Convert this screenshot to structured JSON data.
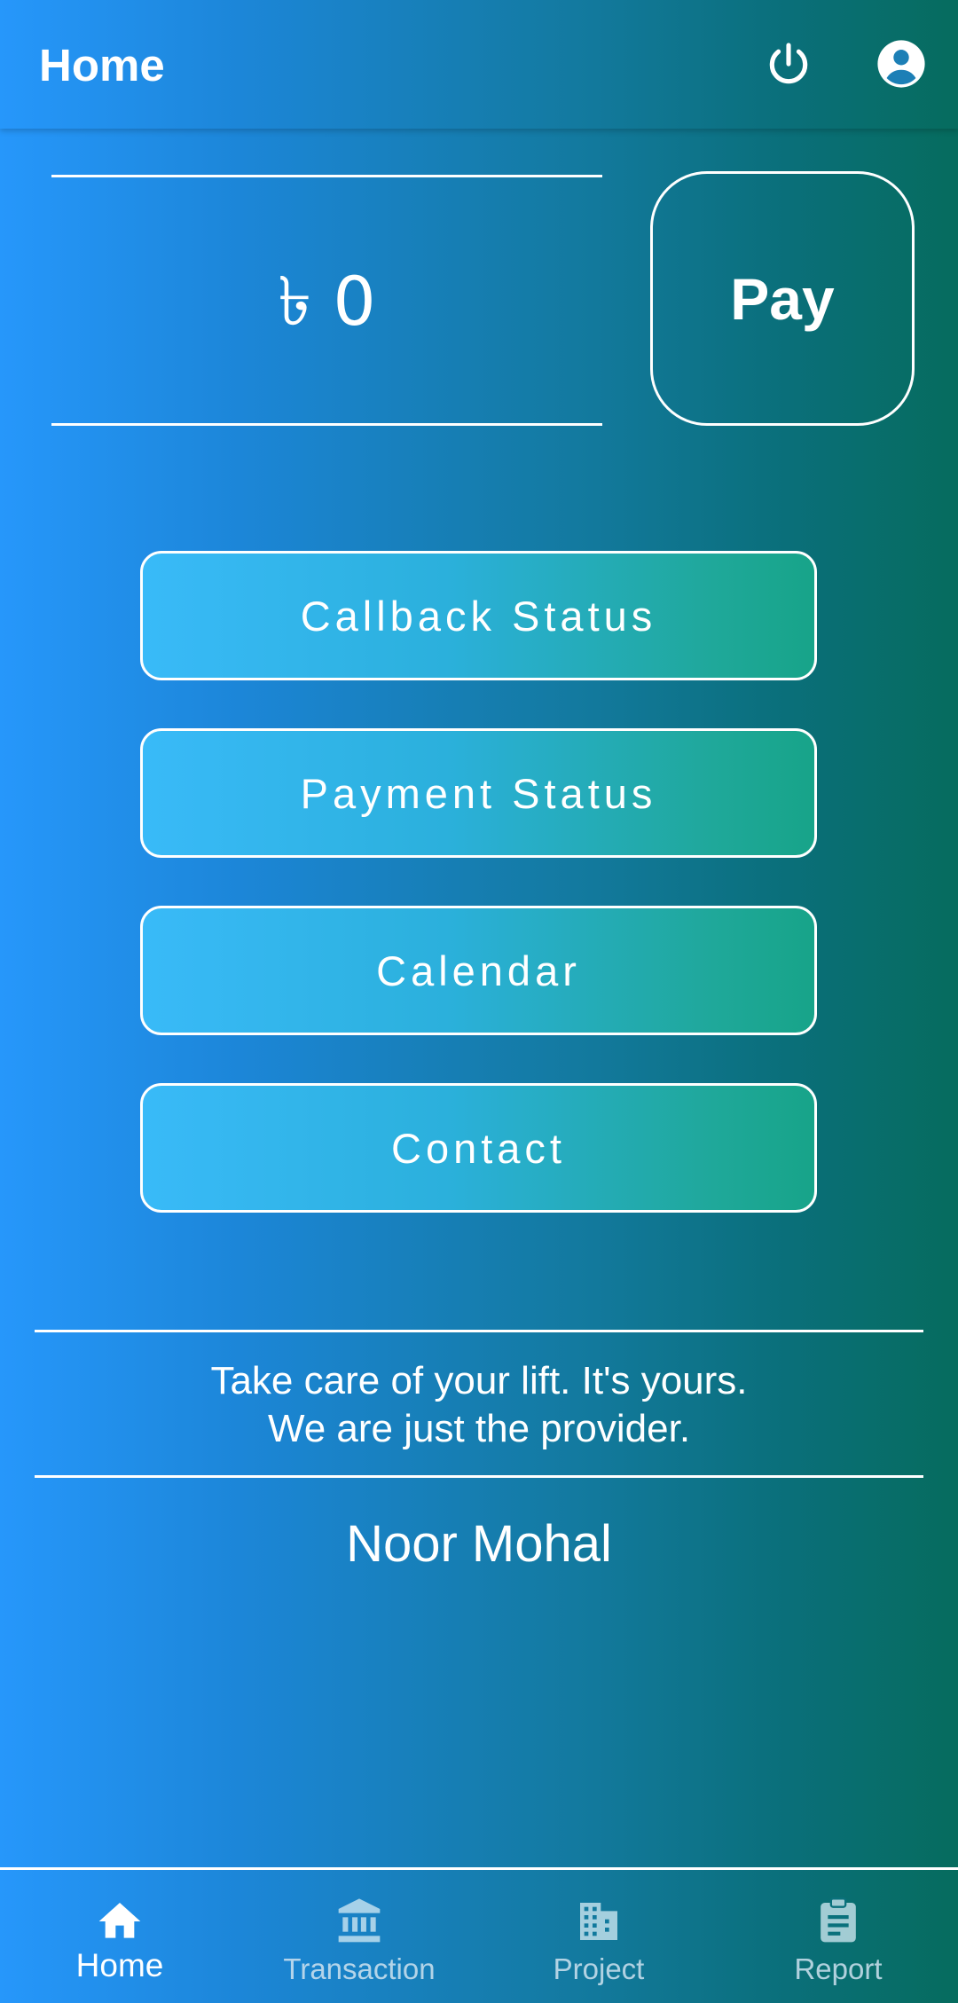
{
  "appbar": {
    "title": "Home",
    "power_icon": "power-icon",
    "account_icon": "account-circle-icon"
  },
  "balance": {
    "amount": "৳ 0"
  },
  "pay_button": {
    "label": "Pay"
  },
  "menu": [
    {
      "label": "Callback Status"
    },
    {
      "label": "Payment Status"
    },
    {
      "label": "Calendar"
    },
    {
      "label": "Contact"
    }
  ],
  "quote": {
    "line1": "Take care of your lift. It's yours.",
    "line2": "We are just the provider."
  },
  "company_name": "Noor Mohal",
  "bottom_nav": [
    {
      "label": "Home",
      "icon": "home-icon",
      "active": true
    },
    {
      "label": "Transaction",
      "icon": "bank-icon",
      "active": false
    },
    {
      "label": "Project",
      "icon": "building-icon",
      "active": false
    },
    {
      "label": "Report",
      "icon": "clipboard-icon",
      "active": false
    }
  ],
  "colors": {
    "gradient_left": "#2697fb",
    "gradient_right": "#066c5e",
    "button_left": "#39baf8",
    "button_right": "#17a489"
  }
}
